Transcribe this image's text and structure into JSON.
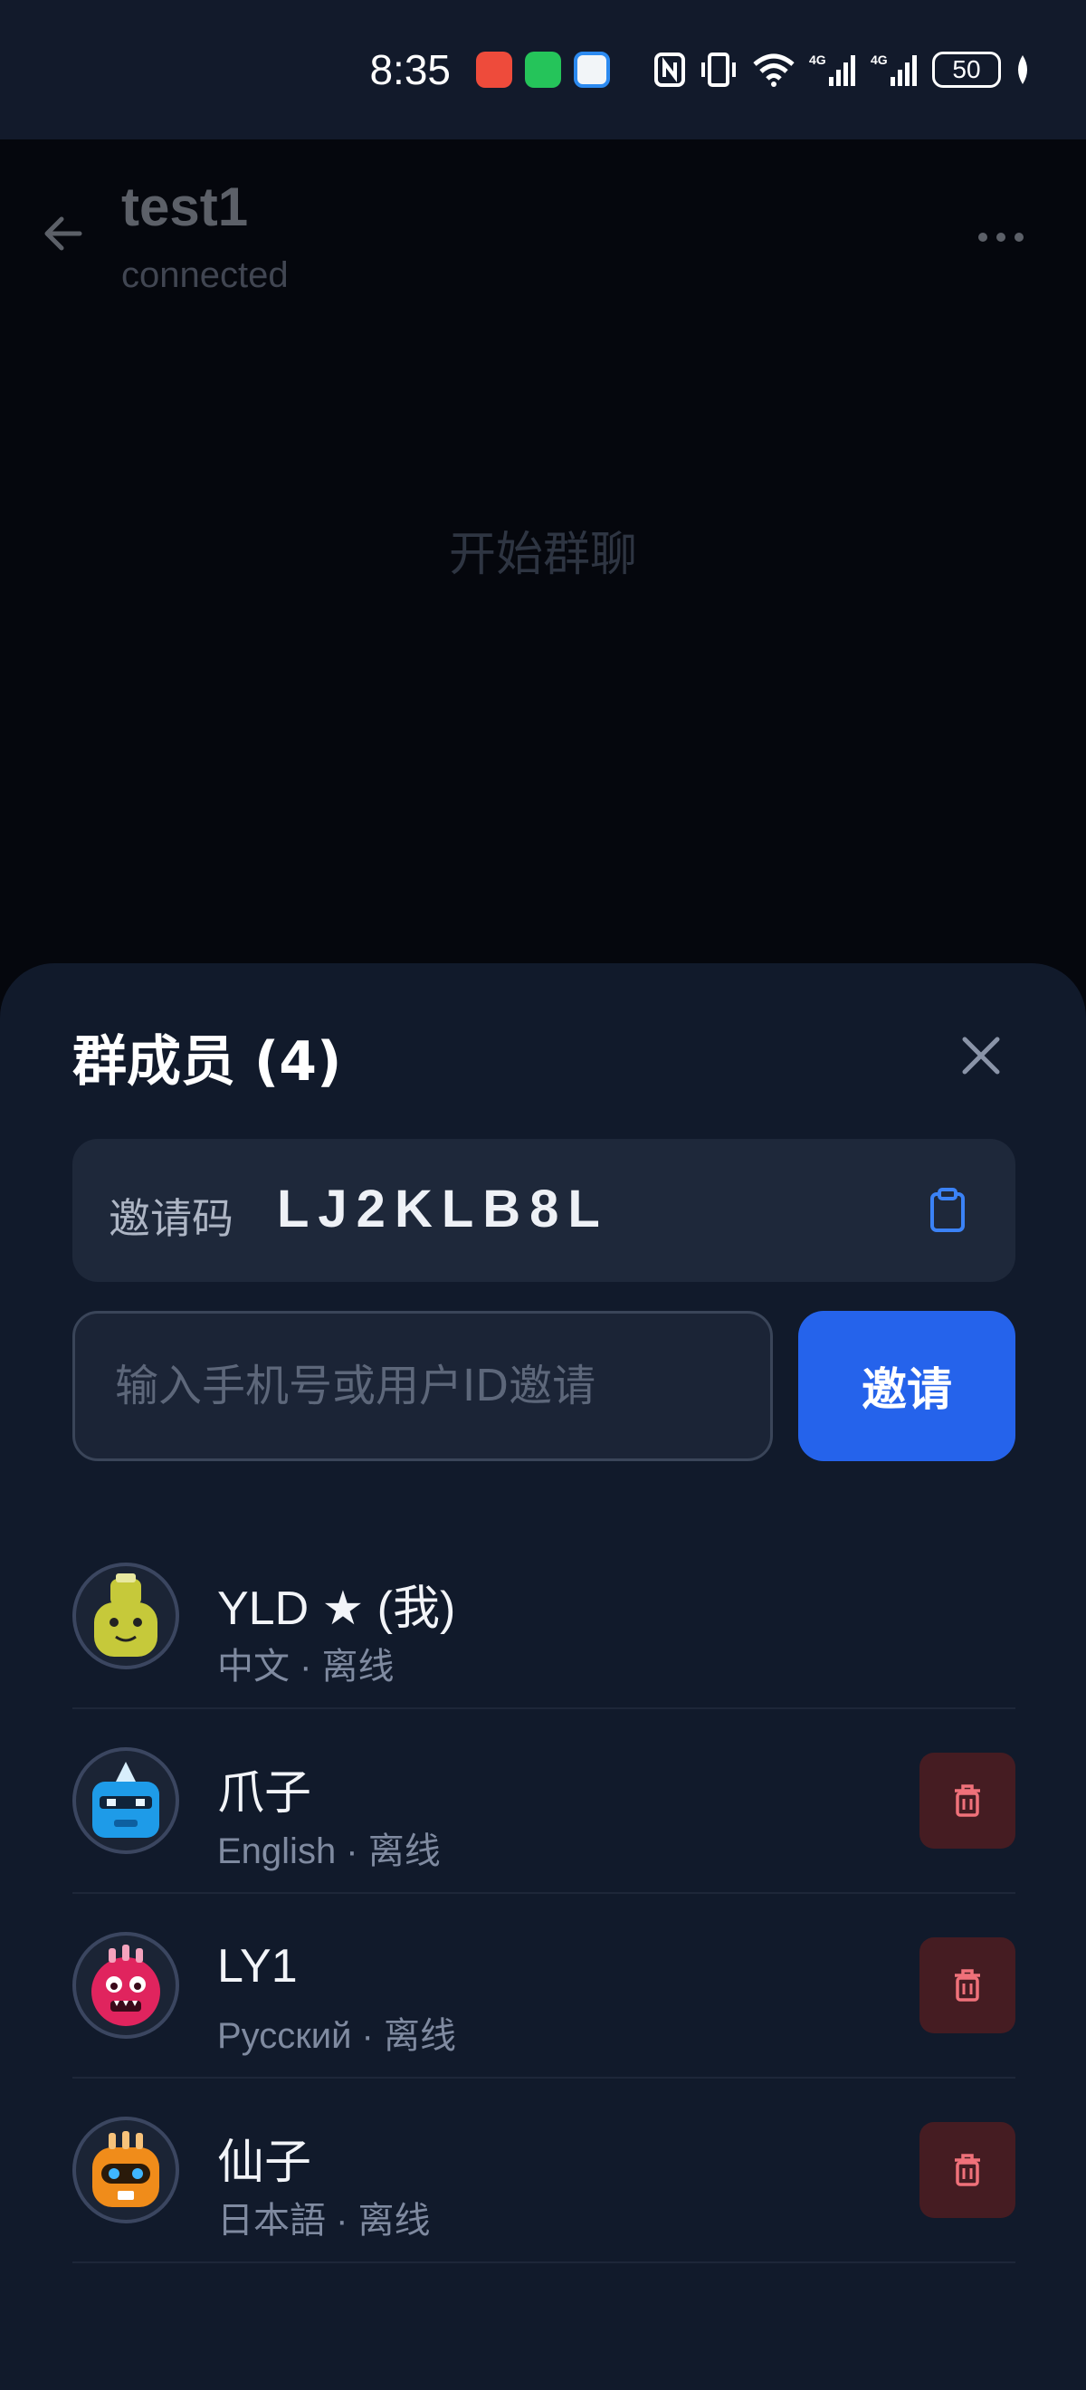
{
  "status_bar": {
    "time": "8:35",
    "battery": "50",
    "icons": [
      "nfc-icon",
      "vibrate-icon",
      "wifi-icon",
      "signal-4g-icon",
      "signal-4g-icon",
      "battery-icon",
      "leaf-icon"
    ]
  },
  "header": {
    "title": "test1",
    "status": "connected"
  },
  "chat": {
    "empty_text": "开始群聊"
  },
  "sheet": {
    "title": "群成员 (4)",
    "invite_code": {
      "label": "邀请码",
      "value": "LJ2KLB8L"
    },
    "invite_input": {
      "placeholder": "输入手机号或用户ID邀请",
      "value": ""
    },
    "invite_button": "邀请",
    "members": [
      {
        "name": "YLD ★ (我)",
        "subtitle": "中文 · 离线",
        "avatar_color": "#c6c93a",
        "deletable": false
      },
      {
        "name": "爪子",
        "subtitle": "English · 离线",
        "avatar_color": "#1e9be8",
        "deletable": true
      },
      {
        "name": "LY1",
        "subtitle": "Русский · 离线",
        "avatar_color": "#e0245e",
        "deletable": true
      },
      {
        "name": "仙子",
        "subtitle": "日本語 · 离线",
        "avatar_color": "#f08c1a",
        "deletable": true
      }
    ]
  },
  "colors": {
    "accent": "#2563eb",
    "delete_bg": "#451c22",
    "delete_icon": "#f0717a",
    "sheet_bg": "#111a2b"
  }
}
